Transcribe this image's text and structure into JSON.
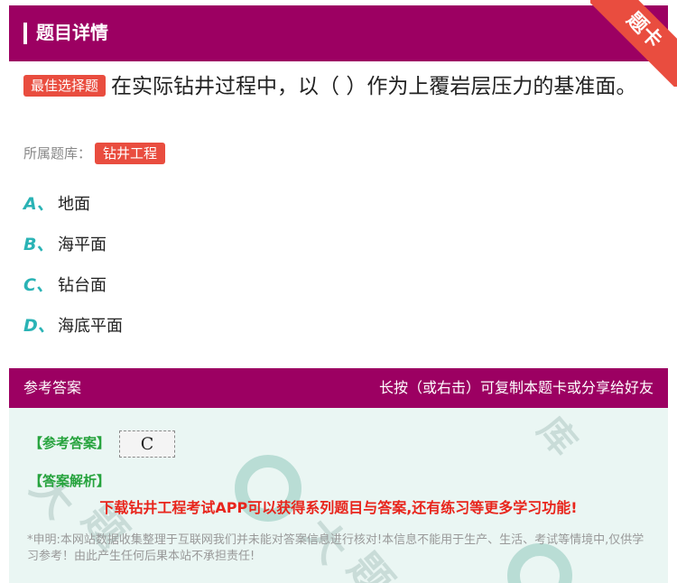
{
  "header": {
    "title": "题目详情",
    "ribbon": "题卡"
  },
  "question": {
    "tag": "最佳选择题",
    "text": "在实际钻井过程中，以（ ）作为上覆岩层压力的基准面。"
  },
  "bank": {
    "label": "所属题库：",
    "name": "钻井工程"
  },
  "options": [
    {
      "letter": "A、",
      "text": "地面"
    },
    {
      "letter": "B、",
      "text": "海平面"
    },
    {
      "letter": "C、",
      "text": "钻台面"
    },
    {
      "letter": "D、",
      "text": "海底平面"
    }
  ],
  "answer": {
    "title": "参考答案",
    "hint": "长按（或右击）可复制本题卡或分享给好友",
    "ref_label": "【参考答案】",
    "ref_value": "C",
    "analysis_label": "【答案解析】",
    "promo": "下载钻井工程考试APP可以获得系列题目与答案,还有练习等更多学习功能!",
    "disclaimer": "*申明:本网站数据收集整理于互联网我们并未能对答案信息进行核对!本信息不能用于生产、生活、考试等情境中,仅供学习参考！由此产生任何后果本站不承担责任!"
  },
  "colors": {
    "header": "#9c0062",
    "accent": "#e94d3f",
    "option_letter": "#2ab3b5",
    "label_green": "#26a33d",
    "promo_red": "#e8251c",
    "answer_bg": "#eaf6f3"
  }
}
